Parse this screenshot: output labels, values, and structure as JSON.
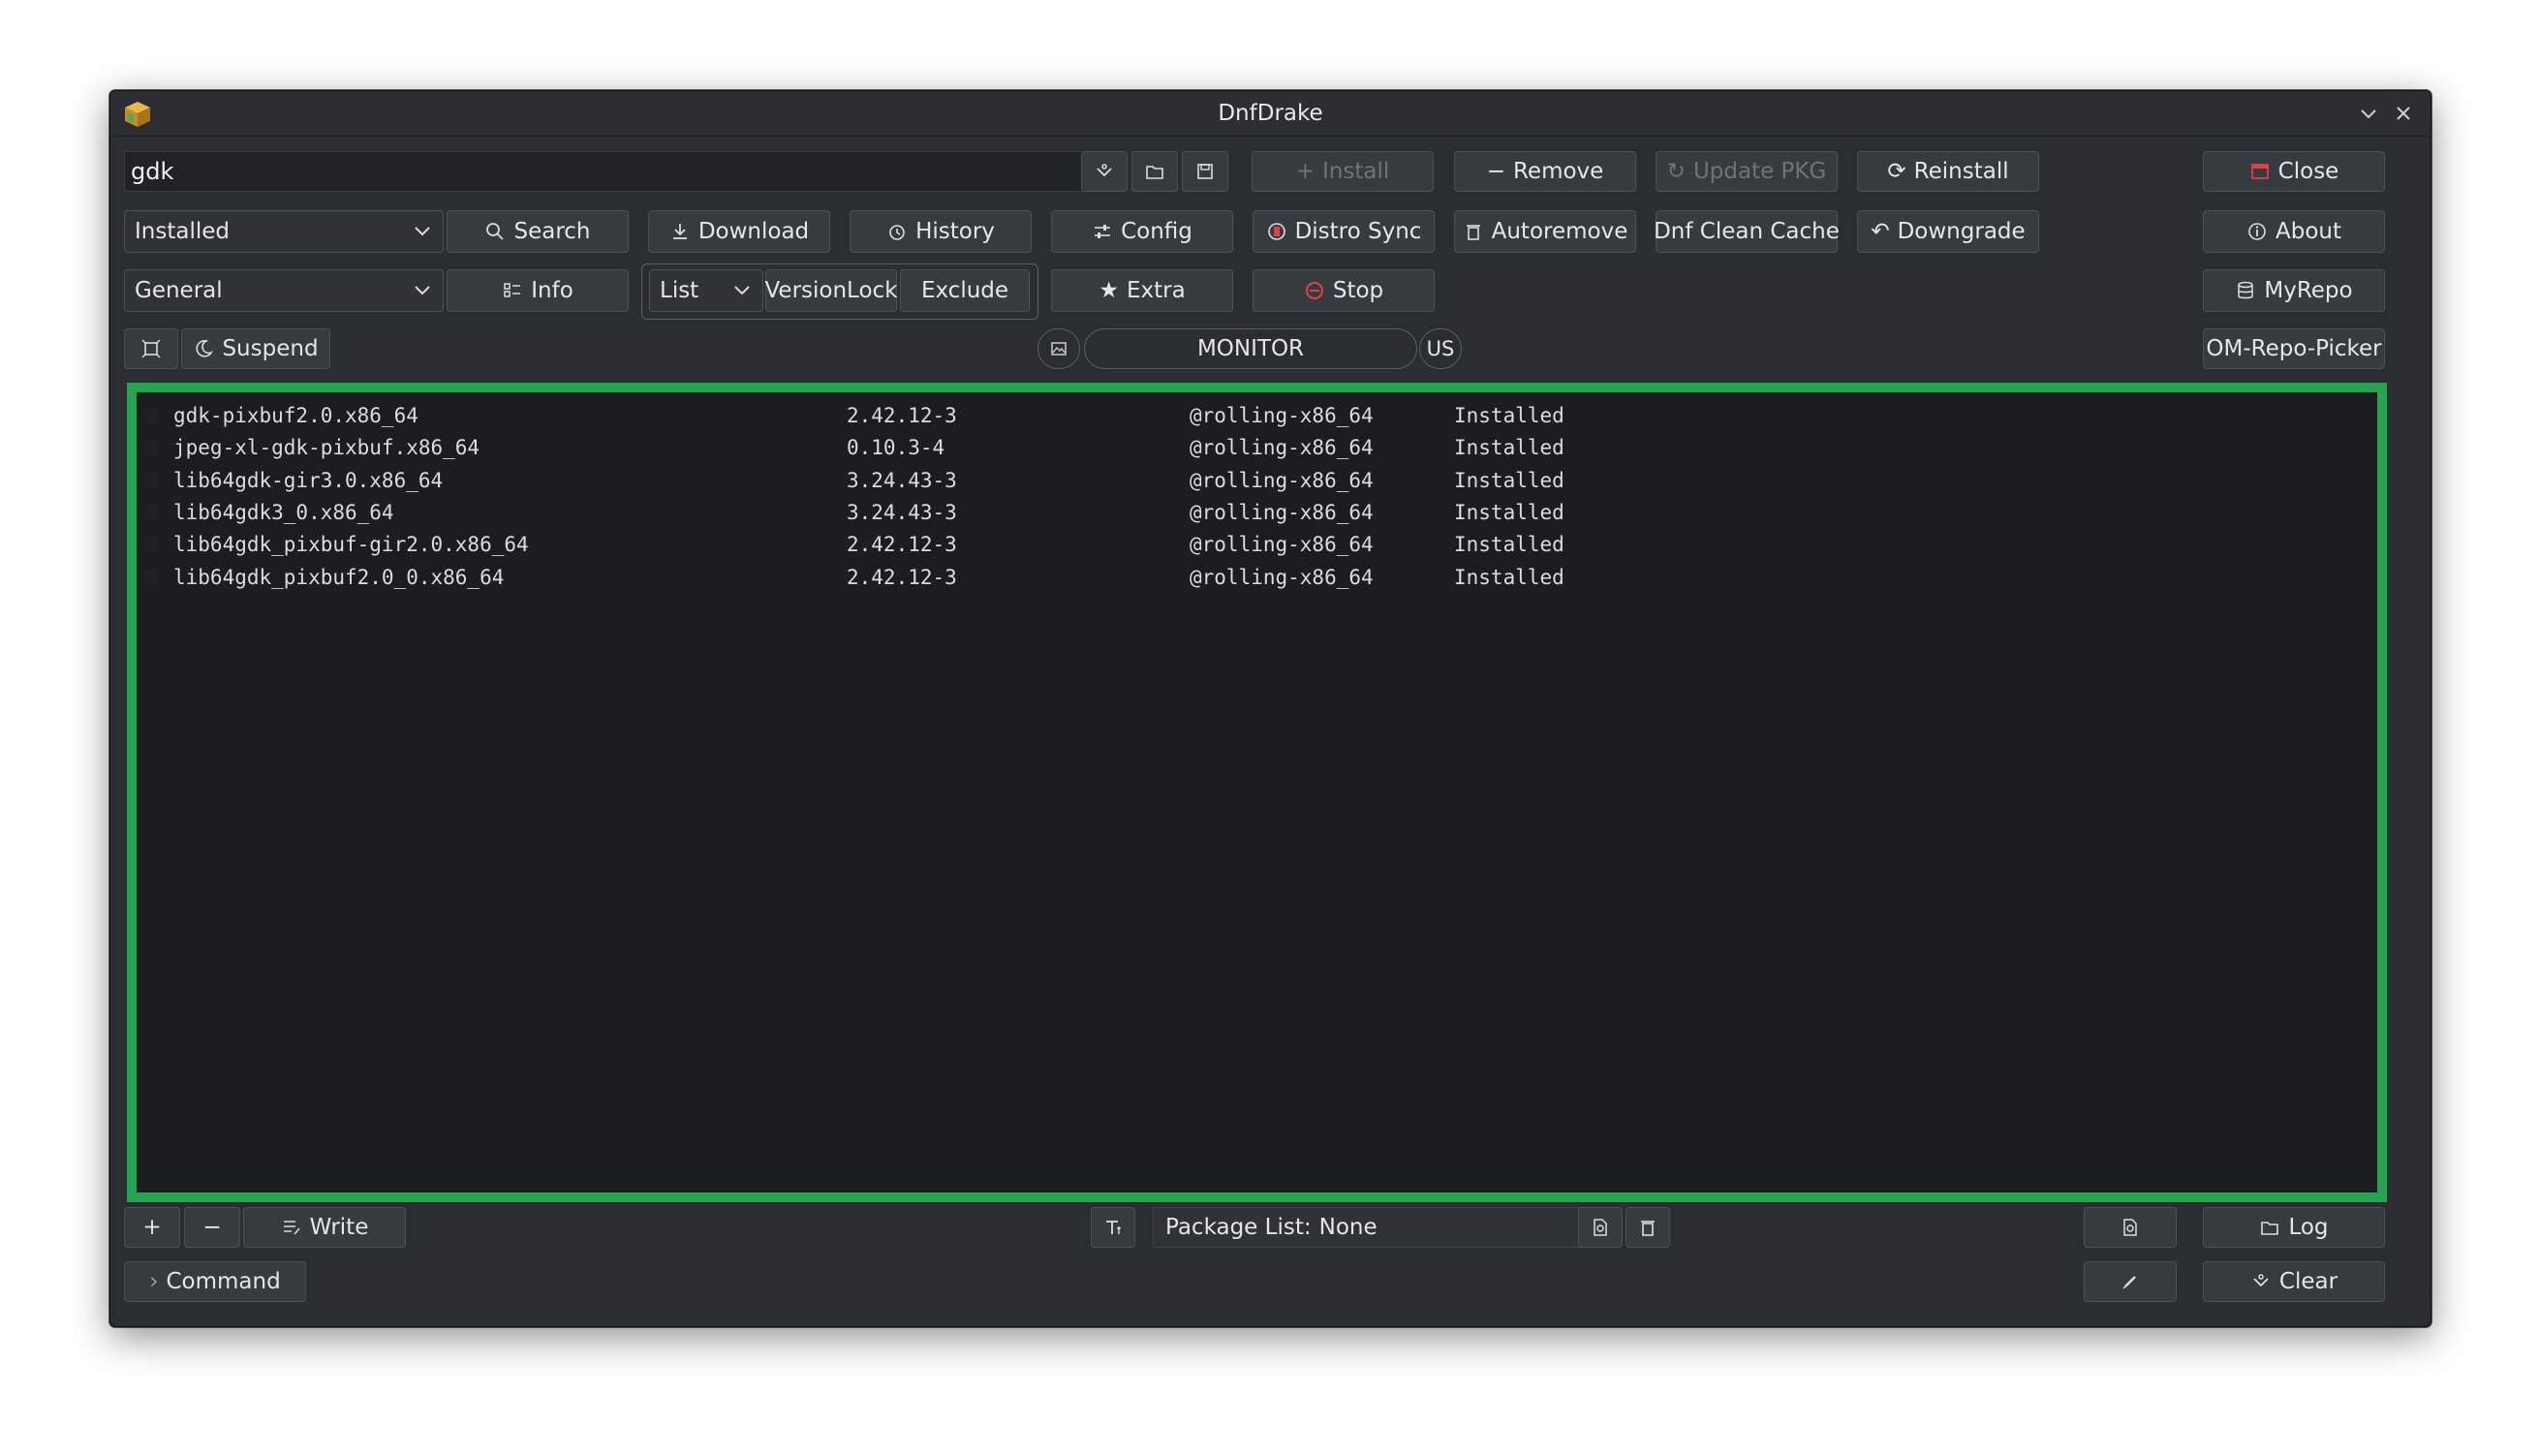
{
  "window": {
    "title": "DnfDrake"
  },
  "search": {
    "value": "gdk"
  },
  "toolbar": {
    "install": "Install",
    "remove": "Remove",
    "update_pkg": "Update PKG",
    "reinstall": "Reinstall",
    "close": "Close",
    "filter_selected": "Installed",
    "search": "Search",
    "download": "Download",
    "history": "History",
    "config": "Config",
    "distro_sync": "Distro Sync",
    "autoremove": "Autoremove",
    "dnf_clean_cache": "Dnf Clean Cache",
    "downgrade": "Downgrade",
    "about": "About",
    "category_selected": "General",
    "info": "Info",
    "list_selected": "List",
    "versionlock": "VersionLock",
    "exclude": "Exclude",
    "extra": "Extra",
    "stop": "Stop",
    "myrepo": "MyRepo",
    "suspend": "Suspend",
    "monitor": "MONITOR",
    "lang": "US",
    "om_repo_picker": "OM-Repo-Picker"
  },
  "packages": [
    {
      "name": "gdk-pixbuf2.0.x86_64",
      "version": "2.42.12-3",
      "repo": "@rolling-x86_64",
      "status": "Installed"
    },
    {
      "name": "jpeg-xl-gdk-pixbuf.x86_64",
      "version": "0.10.3-4",
      "repo": "@rolling-x86_64",
      "status": "Installed"
    },
    {
      "name": "lib64gdk-gir3.0.x86_64",
      "version": "3.24.43-3",
      "repo": "@rolling-x86_64",
      "status": "Installed"
    },
    {
      "name": "lib64gdk3_0.x86_64",
      "version": "3.24.43-3",
      "repo": "@rolling-x86_64",
      "status": "Installed"
    },
    {
      "name": "lib64gdk_pixbuf-gir2.0.x86_64",
      "version": "2.42.12-3",
      "repo": "@rolling-x86_64",
      "status": "Installed"
    },
    {
      "name": "lib64gdk_pixbuf2.0_0.x86_64",
      "version": "2.42.12-3",
      "repo": "@rolling-x86_64",
      "status": "Installed"
    }
  ],
  "bottom": {
    "write": "Write",
    "package_list_label": "Package List:",
    "package_list_value": "None",
    "log": "Log",
    "command": "Command",
    "clear": "Clear"
  },
  "colors": {
    "accent_border": "#25a550",
    "stop_icon": "#e0404a",
    "close_icon": "#e0404a"
  }
}
